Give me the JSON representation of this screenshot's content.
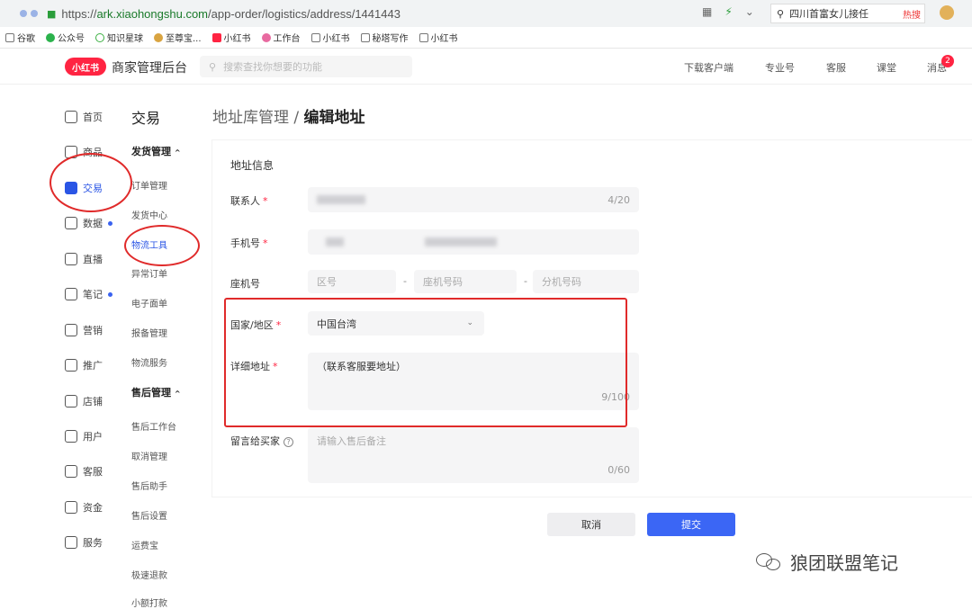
{
  "browser": {
    "url_scheme": "https://",
    "url_host": "ark.xiaohongshu.com",
    "url_path": "/app-order/logistics/address/1441443",
    "search_text": "四川首富女儿接任",
    "hot_label": "热搜"
  },
  "bookmarks": [
    "谷歌",
    "公众号",
    "知识星球",
    "至尊宝...",
    "小红书",
    "工作台",
    "小红书",
    "秘塔写作",
    "小红书"
  ],
  "topnav": {
    "logo": "小红书",
    "brand": "商家管理后台",
    "search_placeholder": "搜索查找你想要的功能",
    "menu": [
      "下载客户端",
      "专业号",
      "客服",
      "课堂",
      "消息"
    ],
    "message_count": "2"
  },
  "leftnav": [
    {
      "label": "首页",
      "dot": false
    },
    {
      "label": "商品",
      "dot": false
    },
    {
      "label": "交易",
      "dot": false,
      "active": true
    },
    {
      "label": "数据",
      "dot": true
    },
    {
      "label": "直播",
      "dot": false
    },
    {
      "label": "笔记",
      "dot": true
    },
    {
      "label": "营销",
      "dot": false
    },
    {
      "label": "推广",
      "dot": false
    },
    {
      "label": "店铺",
      "dot": false
    },
    {
      "label": "用户",
      "dot": false
    },
    {
      "label": "客服",
      "dot": false
    },
    {
      "label": "资金",
      "dot": false
    },
    {
      "label": "服务",
      "dot": false
    }
  ],
  "subnav": {
    "title": "交易",
    "group1": "发货管理",
    "items1": [
      "订单管理",
      "发货中心",
      "物流工具",
      "异常订单",
      "电子面单",
      "报备管理",
      "物流服务"
    ],
    "group2": "售后管理",
    "items2": [
      "售后工作台",
      "取消管理",
      "售后助手",
      "售后设置",
      "运费宝",
      "极速退款",
      "小额打款"
    ]
  },
  "page": {
    "crumb": "地址库管理",
    "separator": " / ",
    "title": "编辑地址",
    "section_title": "地址信息"
  },
  "form": {
    "contact_label": "联系人",
    "contact_counter": "4/20",
    "phone_label": "手机号",
    "landline_label": "座机号",
    "area_placeholder": "区号",
    "landline_placeholder": "座机号码",
    "ext_placeholder": "分机号码",
    "dash": "-",
    "country_label": "国家/地区",
    "country_value": "中国台湾",
    "address_label": "详细地址",
    "address_value": "（联系客服要地址）",
    "address_counter": "9/100",
    "note_label": "留言给买家",
    "note_placeholder": "请输入售后备注",
    "note_counter": "0/60",
    "required_mark": "*"
  },
  "buttons": {
    "cancel": "取消",
    "submit": "提交"
  },
  "watermark": "狼团联盟笔记",
  "colors": {
    "accent": "#3b66f5",
    "brand": "#ff2442",
    "annotation": "#e02a2a"
  }
}
